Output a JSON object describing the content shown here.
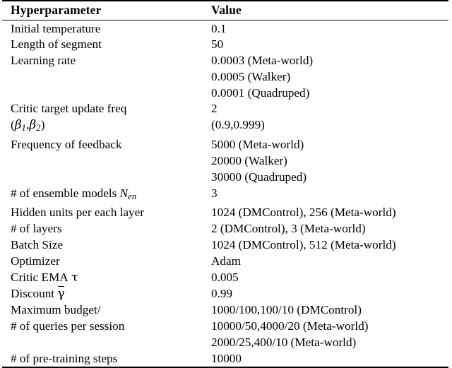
{
  "table": {
    "headers": {
      "parameter": "Hyperparameter",
      "value": "Value"
    },
    "rows": [
      {
        "param": "Initial temperature",
        "value": "0.1"
      },
      {
        "param": "Length of segment",
        "value": "50"
      },
      {
        "param": "Learning rate",
        "value": "0.0003 (Meta-world)"
      },
      {
        "param": "",
        "value": "0.0005 (Walker)"
      },
      {
        "param": "",
        "value": "0.0001 (Quadruped)"
      },
      {
        "param": "Critic target update freq",
        "value": "2"
      },
      {
        "param": "(β1,β2)",
        "value": "(0.9,0.999)"
      },
      {
        "param": "Frequency of feedback",
        "value": "5000 (Meta-world)"
      },
      {
        "param": "",
        "value": "20000 (Walker)"
      },
      {
        "param": "",
        "value": "30000 (Quadruped)"
      },
      {
        "param": "# of ensemble models Nen",
        "value": "3"
      },
      {
        "param": "Hidden units per each layer",
        "value": "1024 (DMControl), 256 (Meta-world)"
      },
      {
        "param": "# of layers",
        "value": "2 (DMControl), 3 (Meta-world)"
      },
      {
        "param": "Batch Size",
        "value": "1024 (DMControl), 512 (Meta-world)"
      },
      {
        "param": "Optimizer",
        "value": "Adam"
      },
      {
        "param": "Critic EMA τ",
        "value": "0.005"
      },
      {
        "param": "Discount γ̄",
        "value": "0.99"
      },
      {
        "param": "Maximum budget/",
        "value": "1000/100,100/10 (DMControl)"
      },
      {
        "param": "# of queries per session",
        "value": "10000/50,4000/20 (Meta-world)"
      },
      {
        "param": "",
        "value": "2000/25,400/10 (Meta-world)"
      },
      {
        "param": "# of pre-training steps",
        "value": "10000"
      }
    ],
    "symbols": {
      "beta": "β",
      "beta_sub_1": "1",
      "beta_sub_2": "2",
      "ensemble_symbol": "N",
      "ensemble_subscript": "en",
      "tau": "τ",
      "gamma": "γ",
      "hash": "#",
      "paren_open": "(",
      "paren_close": ")",
      "comma": ","
    },
    "labels": {
      "ensemble_prefix": "# of ensemble models",
      "critic_ema_prefix": "Critic EMA",
      "discount_prefix": "Discount"
    },
    "colors": {
      "text": "#000000",
      "rule": "#000000",
      "background": "#ffffff"
    }
  }
}
